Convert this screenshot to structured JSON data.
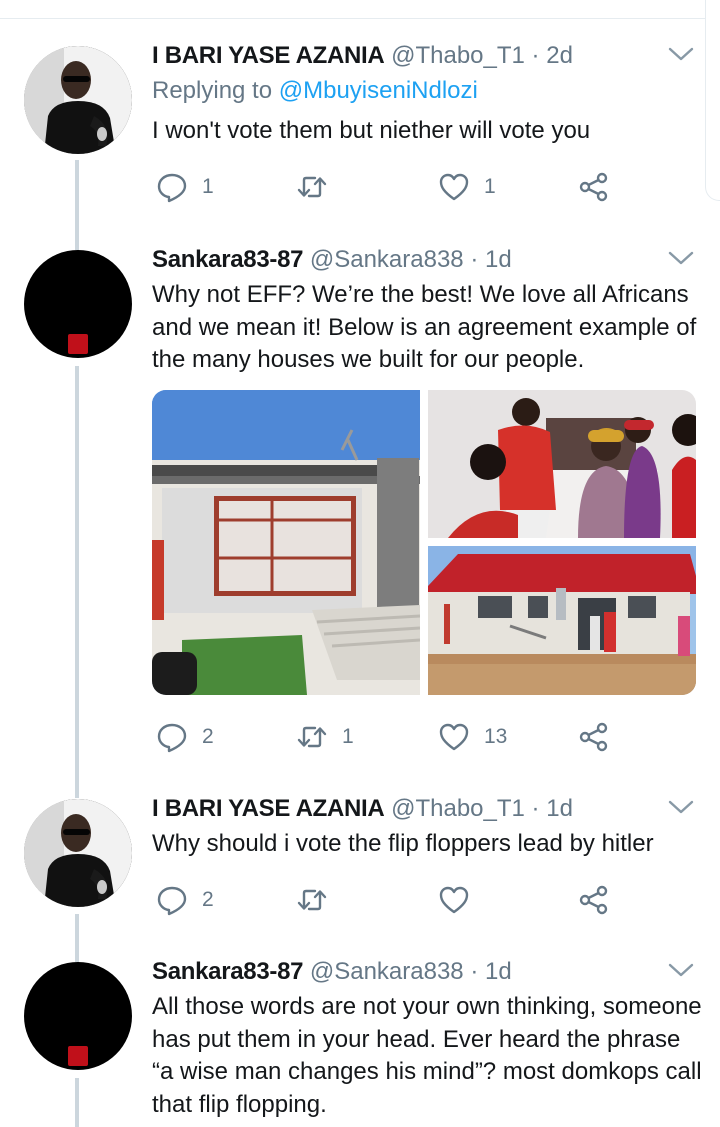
{
  "tweets": [
    {
      "name": "I BARI YASE AZANIA",
      "handle": "@Thabo_T1",
      "time": "2d",
      "replying_label": "Replying to",
      "replying_to": "@MbuyiseniNdlozi",
      "text": "I won't vote them but niether will vote you",
      "replies": "1",
      "retweets": "",
      "likes": "1"
    },
    {
      "name": "Sankara83-87",
      "handle": "@Sankara838",
      "time": "1d",
      "text": "Why not EFF? We’re the best! We love all Africans and we mean it! Below is an agreement example of the many houses we built for our people.",
      "replies": "2",
      "retweets": "1",
      "likes": "13"
    },
    {
      "name": "I BARI YASE AZANIA",
      "handle": "@Thabo_T1",
      "time": "1d",
      "text": "Why should i vote the flip floppers lead by hitler",
      "replies": "2",
      "retweets": "",
      "likes": ""
    },
    {
      "name": "Sankara83-87",
      "handle": "@Sankara838",
      "time": "1d",
      "text": "All those words are not your own thinking, someone has put them in your head. Ever heard the phrase “a wise man changes his mind”? most domkops call that flip flopping."
    }
  ],
  "separator": "·",
  "icons": {
    "reply": "reply-icon",
    "retweet": "retweet-icon",
    "like": "heart-icon",
    "share": "share-icon",
    "menu": "chevron-down-icon"
  },
  "colors": {
    "text": "#14171a",
    "secondary": "#657786",
    "link": "#1da1f2",
    "thread_line": "#ccd6dd"
  }
}
